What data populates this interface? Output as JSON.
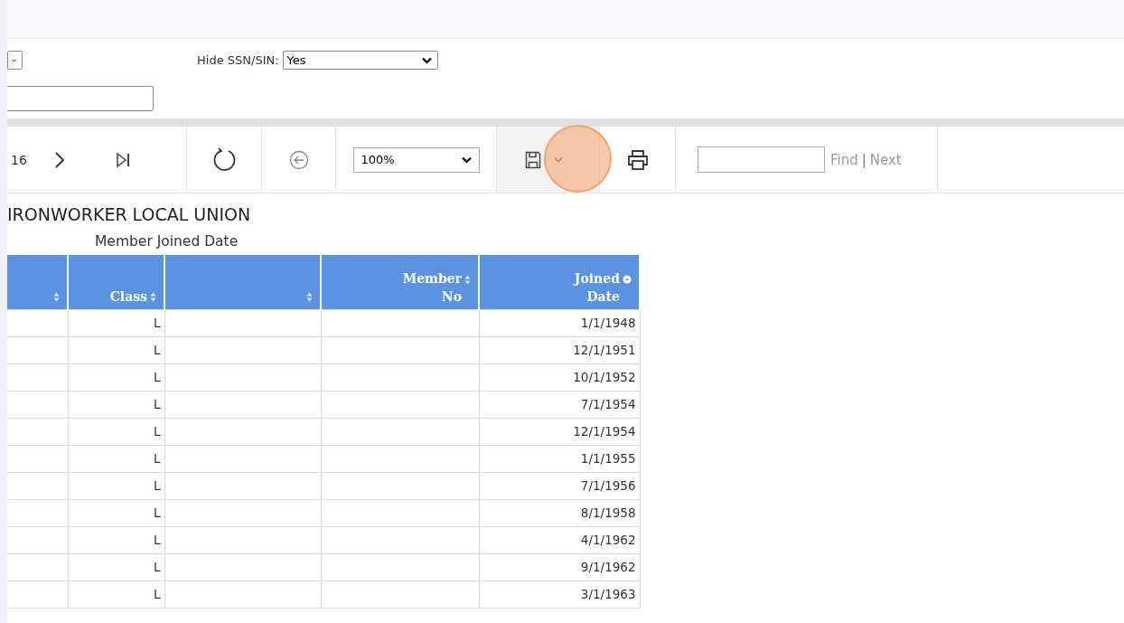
{
  "parameters": {
    "hide_ssn": {
      "label": "Hide SSN/SIN:",
      "value": "Yes"
    }
  },
  "toolbar": {
    "page_count": "16",
    "zoom": "100%",
    "find_link": "Find",
    "separator": "|",
    "next_link": "Next",
    "save_highlighted": true
  },
  "report": {
    "title": "IRONWORKER LOCAL UNION",
    "subtitle": "Member Joined Date",
    "columns": [
      {
        "sorted": false
      },
      {
        "label": "Class",
        "sorted": false
      },
      {
        "sorted": false
      },
      {
        "label": "Member\nNo",
        "sorted": false
      },
      {
        "label": "Joined\nDate",
        "sorted": true
      }
    ],
    "rows": [
      {
        "class": "L",
        "joined_date": "1/1/1948"
      },
      {
        "class": "L",
        "joined_date": "12/1/1951"
      },
      {
        "class": "L",
        "joined_date": "10/1/1952"
      },
      {
        "class": "L",
        "joined_date": "7/1/1954"
      },
      {
        "class": "L",
        "joined_date": "12/1/1954"
      },
      {
        "class": "L",
        "joined_date": "1/1/1955"
      },
      {
        "class": "L",
        "joined_date": "7/1/1956"
      },
      {
        "class": "L",
        "joined_date": "8/1/1958"
      },
      {
        "class": "L",
        "joined_date": "4/1/1962"
      },
      {
        "class": "L",
        "joined_date": "9/1/1962"
      },
      {
        "class": "L",
        "joined_date": "3/1/1963"
      }
    ]
  }
}
